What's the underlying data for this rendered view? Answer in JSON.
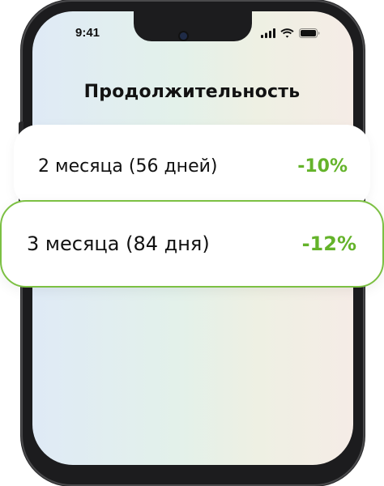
{
  "status_bar": {
    "time": "9:41",
    "icons": [
      "signal-icon",
      "wifi-icon",
      "battery-icon"
    ]
  },
  "screen": {
    "title": "Продолжительность"
  },
  "options": [
    {
      "label": "2 месяца (56 дней)",
      "discount": "-10%",
      "selected": false
    },
    {
      "label": "3 месяца (84 дня)",
      "discount": "-12%",
      "selected": true
    }
  ],
  "colors": {
    "accent_green": "#64b32a",
    "selected_border": "#7cc043",
    "phone_frame": "#1c1c1e"
  }
}
